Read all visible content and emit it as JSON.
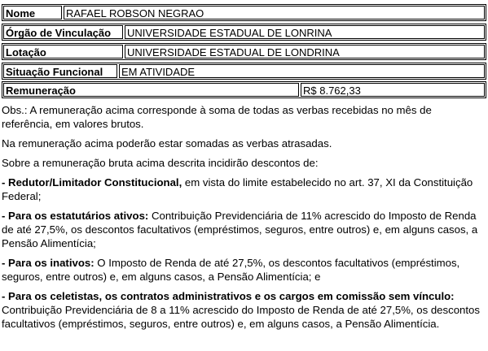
{
  "table": {
    "rows": [
      {
        "label": "Nome",
        "value": "RAFAEL ROBSON NEGRAO"
      },
      {
        "label": "Órgão de Vinculação",
        "value": "UNIVERSIDADE ESTADUAL DE LONRINA"
      },
      {
        "label": "Lotação",
        "value": "UNIVERSIDADE ESTADUAL DE LONDRINA"
      },
      {
        "label": "Situação Funcional",
        "value": "EM ATIVIDADE"
      },
      {
        "label": "Remuneração",
        "value": "R$ 8.762,33"
      }
    ]
  },
  "notes": {
    "obs": "Obs.: A remuneração acima corresponde à soma de todas as verbas recebidas no mês de referência, em valores brutos.",
    "atrasadas": "Na remuneração acima poderão estar somadas as verbas atrasadas.",
    "descontos_intro": "Sobre a remuneração bruta acima descrita incidirão descontos de:",
    "redutor_title": "- Redutor/Limitador Constitucional,",
    "redutor_text": " em vista do limite estabelecido no art. 37, XI da Constituição Federal;",
    "estatutarios_title": "- Para os estatutários ativos:",
    "estatutarios_text": " Contribuição Previdenciária de 11% acrescido do Imposto de Renda de até 27,5%, os descontos facultativos (empréstimos, seguros, entre outros) e, em alguns casos, a Pensão Alimentícia;",
    "inativos_title": "- Para os inativos:",
    "inativos_text": " O Imposto de Renda de até 27,5%, os descontos facultativos (empréstimos, seguros, entre outros) e, em alguns casos, a Pensão Alimentícia; e",
    "celetistas_title": "- Para os celetistas, os contratos administrativos e os cargos em comissão sem vínculo:",
    "celetistas_text": " Contribuição Previdenciária de 8 a 11% acrescido do Imposto de Renda de até 27,5%, os descontos facultativos (empréstimos, seguros, entre outros) e, em alguns casos, a Pensão Alimentícia."
  }
}
